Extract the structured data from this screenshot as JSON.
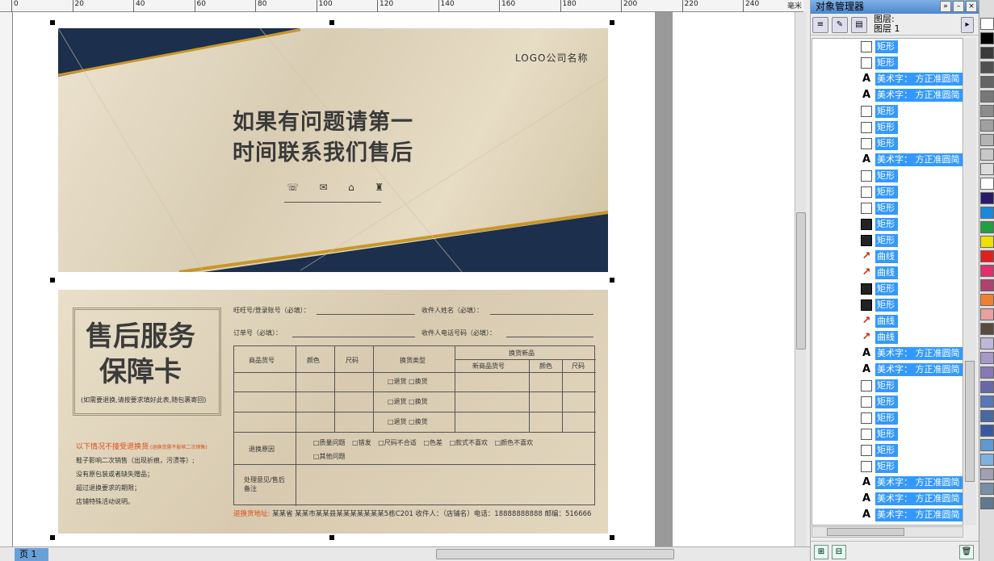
{
  "ruler": {
    "unit": "毫米",
    "ticks": [
      "0",
      "20",
      "40",
      "60",
      "80",
      "100",
      "120",
      "140",
      "160",
      "180",
      "200",
      "220",
      "240"
    ]
  },
  "page_tab": "页 1",
  "front": {
    "logo": "LOGO公司名称",
    "headline_1": "如果有问题请第一",
    "headline_2": "时间联系我们售后",
    "icons": [
      "☏",
      "✉",
      "⌂",
      "♜"
    ]
  },
  "back": {
    "title_1": "售后服务",
    "title_2": "保障卡",
    "subnote": "(如需要退换,请按要求填好此表,随包裹寄回)",
    "warning": "以下情况不接受退换货",
    "warning_sub": ":(退换货需不影响二次销售)",
    "rules": [
      "鞋子影响二次销售（出现折痕，污渍等）;",
      "没有原包装或者缺失赠品；",
      "超过退换要求的期限；",
      "店铺特殊活动说明。"
    ],
    "fields": {
      "wangwang": "旺旺号/登录账号（必填）：",
      "receiver_name": "收件人姓名（必填）：",
      "order_no": "订单号（必填）：",
      "receiver_phone": "收件人电话号码（必填）："
    },
    "table": {
      "h_goods": "商品货号",
      "h_color": "颜色",
      "h_size": "尺码",
      "h_type": "换货类型",
      "h_exchange": "换货新品",
      "h_new_goods": "新商品货号",
      "h_new_color": "颜色",
      "h_new_size": "尺码",
      "opt_return": "□退货",
      "opt_exchange": "□换货",
      "reason_label": "退换原因",
      "reasons": [
        "□质量问题",
        "□错发",
        "□尺码不合适",
        "□色差",
        "□款式不喜欢",
        "□颜色不喜欢"
      ],
      "other": "□其他问题",
      "remark_label": "处理意见/售后备注"
    },
    "address_label": "退换货地址:",
    "address": "某某省 某某市某某县某某某某某某某5栋C201 收件人：（店铺名）电话：18888888888 邮编：516666"
  },
  "panel": {
    "title": "对象管理器",
    "layer_a": "图层:",
    "layer_b": "图层 1",
    "rows": [
      {
        "icon": "box",
        "label": "矩形"
      },
      {
        "icon": "box",
        "label": "矩形"
      },
      {
        "icon": "A",
        "label": "美术字： 方正准圆简"
      },
      {
        "icon": "A",
        "label": "美术字： 方正准圆简"
      },
      {
        "icon": "box",
        "label": "矩形"
      },
      {
        "icon": "box",
        "label": "矩形"
      },
      {
        "icon": "box",
        "label": "矩形"
      },
      {
        "icon": "A",
        "label": "美术字： 方正准圆简"
      },
      {
        "icon": "box",
        "label": "矩形"
      },
      {
        "icon": "box",
        "label": "矩形"
      },
      {
        "icon": "box",
        "label": "矩形"
      },
      {
        "icon": "fill",
        "label": "矩形"
      },
      {
        "icon": "fill",
        "label": "矩形"
      },
      {
        "icon": "curve",
        "label": "曲线"
      },
      {
        "icon": "curve",
        "label": "曲线"
      },
      {
        "icon": "fill",
        "label": "矩形"
      },
      {
        "icon": "fill",
        "label": "矩形"
      },
      {
        "icon": "curve",
        "label": "曲线"
      },
      {
        "icon": "curve",
        "label": "曲线"
      },
      {
        "icon": "A",
        "label": "美术字： 方正准圆简"
      },
      {
        "icon": "A",
        "label": "美术字： 方正准圆简"
      },
      {
        "icon": "box",
        "label": "矩形"
      },
      {
        "icon": "box",
        "label": "矩形"
      },
      {
        "icon": "box",
        "label": "矩形"
      },
      {
        "icon": "box",
        "label": "矩形"
      },
      {
        "icon": "box",
        "label": "矩形"
      },
      {
        "icon": "box",
        "label": "矩形"
      },
      {
        "icon": "A",
        "label": "美术字： 方正准圆简"
      },
      {
        "icon": "A",
        "label": "美术字： 方正准圆简"
      },
      {
        "icon": "A",
        "label": "美术字： 方正准圆简"
      }
    ]
  },
  "palette": [
    "#ffffff",
    "#000000",
    "#3a3a3a",
    "#505050",
    "#646464",
    "#787878",
    "#8c8c8c",
    "#a0a0a0",
    "#b4b4b4",
    "#c8c8c8",
    "#dcdcdc",
    "#ffffff",
    "#2a1a6a",
    "#1a8ad8",
    "#20a040",
    "#f0e000",
    "#e02020",
    "#e03070",
    "#b04070",
    "#f08030",
    "#e8a0a0",
    "#5a4a40",
    "#c0b8d8",
    "#a898c8",
    "#8878b8",
    "#6868a8",
    "#5878b8",
    "#4868a0",
    "#3858a0",
    "#6098d0",
    "#80b0e0",
    "#a0a0b0",
    "#7890a8",
    "#607890"
  ]
}
